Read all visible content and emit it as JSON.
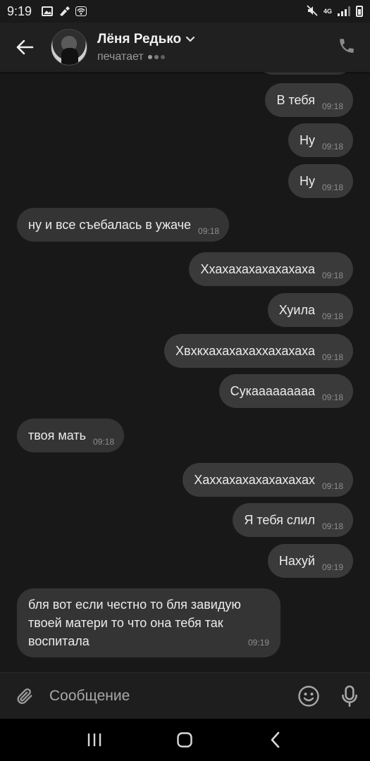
{
  "status_bar": {
    "time": "9:19",
    "network": "4G"
  },
  "header": {
    "name": "Лёня Редько",
    "status": "печатает"
  },
  "messages": [
    {
      "dir": "out",
      "text": "В тебя",
      "time": "09:18"
    },
    {
      "dir": "out",
      "text": "Ну",
      "time": "09:18"
    },
    {
      "dir": "out",
      "text": "Ну",
      "time": "09:18"
    },
    {
      "dir": "in",
      "text": "ну и все съебалась в ужаче",
      "time": "09:18"
    },
    {
      "dir": "out",
      "text": "Ххахахахахахахаха",
      "time": "09:18"
    },
    {
      "dir": "out",
      "text": "Хуила",
      "time": "09:18"
    },
    {
      "dir": "out",
      "text": "Хвхкхахахахаххахахаха",
      "time": "09:18"
    },
    {
      "dir": "out",
      "text": "Сукааааааааа",
      "time": "09:18"
    },
    {
      "dir": "in",
      "text": "твоя мать",
      "time": "09:18"
    },
    {
      "dir": "out",
      "text": "Хаххахахахахахахах",
      "time": "09:18"
    },
    {
      "dir": "out",
      "text": "Я тебя слил",
      "time": "09:18"
    },
    {
      "dir": "out",
      "text": "Нахуй",
      "time": "09:19"
    },
    {
      "dir": "in",
      "text": "бля вот если честно то бля завидую твоей матери то что она тебя так воспитала",
      "time": "09:19"
    }
  ],
  "composer": {
    "placeholder": "Сообщение"
  },
  "colors": {
    "background": "#181818",
    "bubble": "#3a3a3a",
    "header": "#202020"
  }
}
